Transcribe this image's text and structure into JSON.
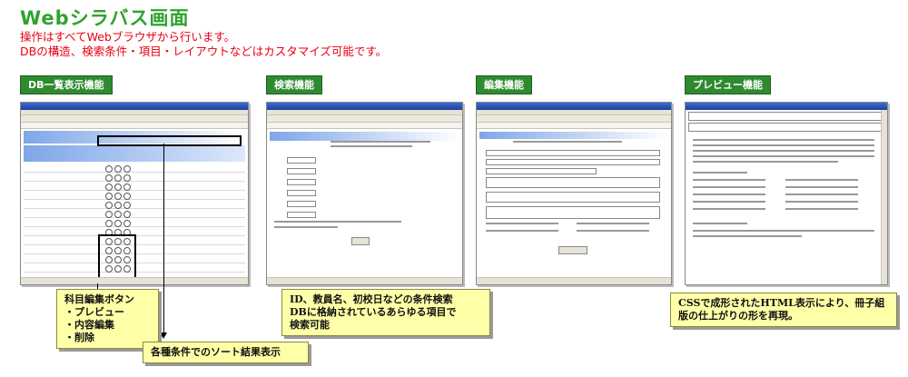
{
  "title": "Webシラバス画面",
  "subtitle": [
    "操作はすべてWebブラウザから行います。",
    "DBの構造、検索条件・項目・レイアウトなどはカスタマイズ可能です。"
  ],
  "sections": [
    {
      "label": "DB一覧表示機能"
    },
    {
      "label": "検索機能"
    },
    {
      "label": "編集機能"
    },
    {
      "label": "プレビュー機能"
    }
  ],
  "callouts": {
    "edit_buttons": [
      "科目編集ボタン",
      "・プレビュー",
      "・内容編集",
      "・削除"
    ],
    "sort_result": "各種条件でのソート結果表示",
    "search_desc": [
      "ID、教員名、初校日などの条件検索",
      "DBに格納されているあらゆる項目で",
      "検索可能"
    ],
    "preview_desc": [
      "CSSで成形されたHTML表示により、冊子組",
      "版の仕上がりの形を再現。"
    ]
  },
  "colors": {
    "title": "#2fa32f",
    "subtitle": "#e60012",
    "section_bg": "#2f8a2f",
    "callout_bg": "#ffffa8"
  }
}
